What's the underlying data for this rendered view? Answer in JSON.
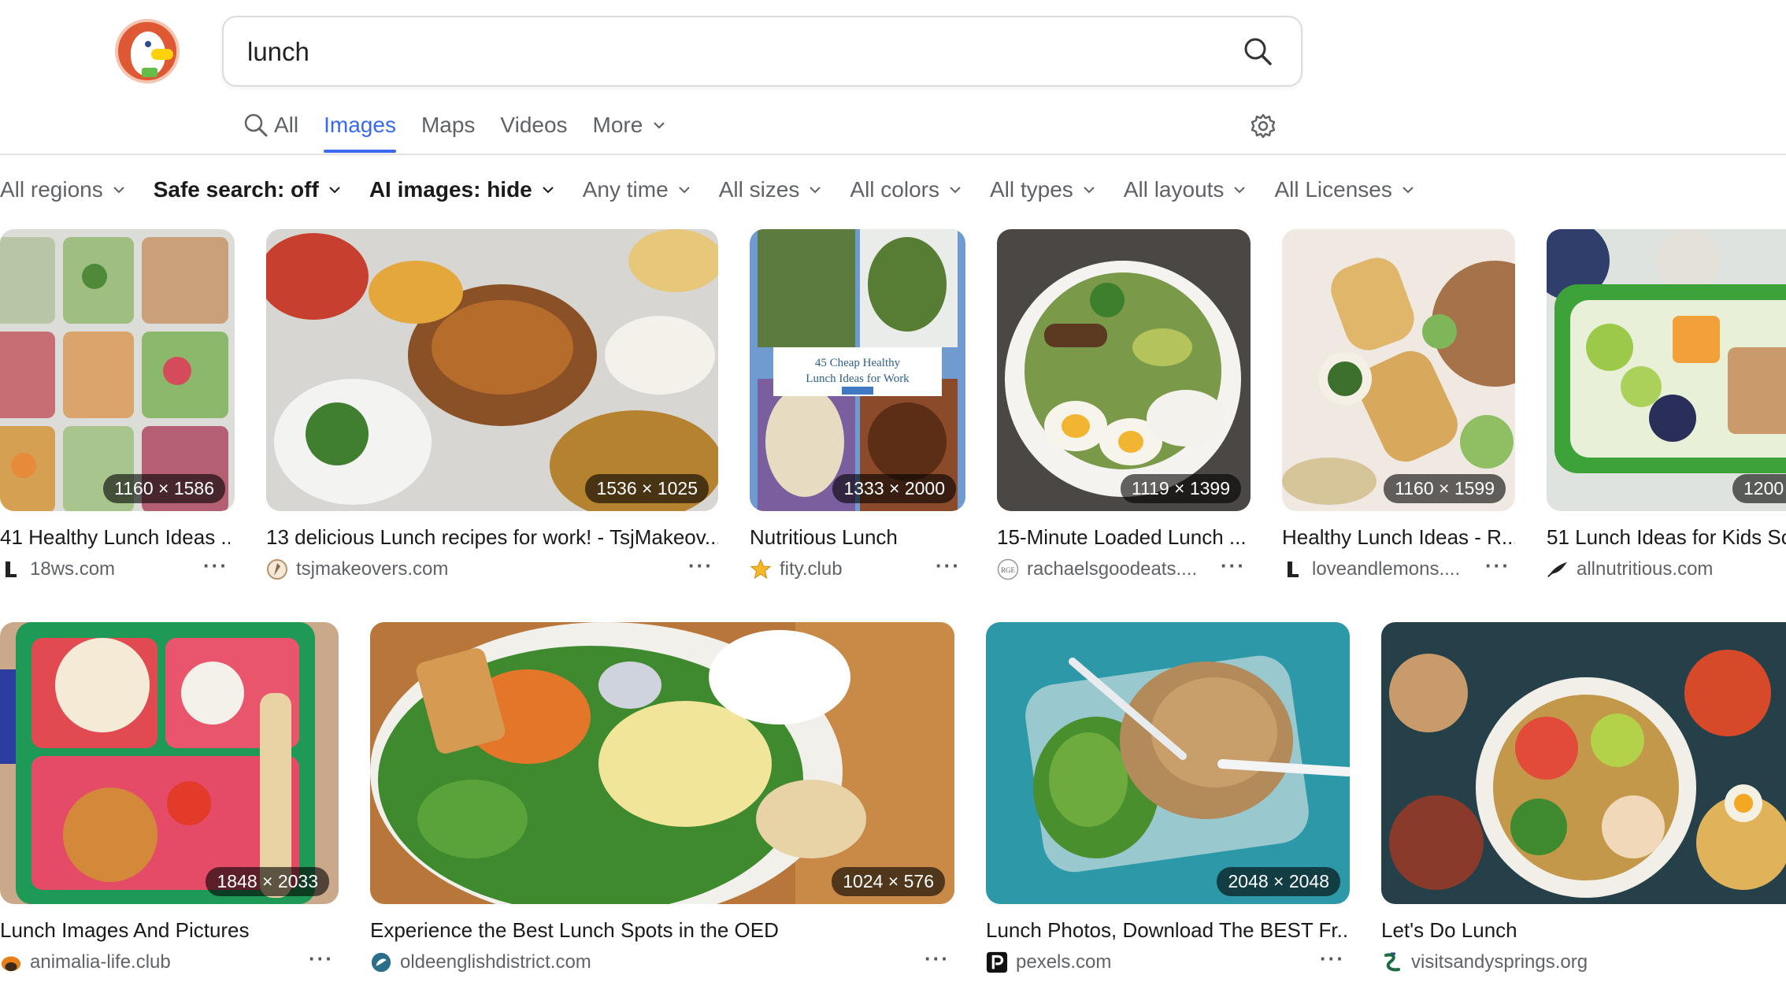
{
  "search": {
    "query": "lunch"
  },
  "tabs": [
    {
      "label": "All"
    },
    {
      "label": "Images"
    },
    {
      "label": "Maps"
    },
    {
      "label": "Videos"
    },
    {
      "label": "More"
    }
  ],
  "filters": [
    {
      "label": "All regions"
    },
    {
      "label": "Safe search: off"
    },
    {
      "label": "AI images: hide"
    },
    {
      "label": "Any time"
    },
    {
      "label": "All sizes"
    },
    {
      "label": "All colors"
    },
    {
      "label": "All types"
    },
    {
      "label": "All layouts"
    },
    {
      "label": "All Licenses"
    }
  ],
  "results": [
    {
      "title": "41 Healthy Lunch Ideas ...",
      "source": "18ws.com",
      "dims": "1160 × 1586"
    },
    {
      "title": "13 delicious Lunch recipes for work! - TsjMakeov...",
      "source": "tsjmakeovers.com",
      "dims": "1536 × 1025"
    },
    {
      "title": "Nutritious Lunch",
      "source": "fity.club",
      "dims": "1333 × 2000",
      "overlay_title": "45 Cheap Healthy",
      "overlay_subtitle": "Lunch Ideas for Work"
    },
    {
      "title": "15-Minute Loaded Lunch ...",
      "source": "rachaelsgoodeats....",
      "dims": "1119 × 1399"
    },
    {
      "title": "Healthy Lunch Ideas - R...",
      "source": "loveandlemons....",
      "dims": "1160 × 1599"
    },
    {
      "title": "51 Lunch Ideas for Kids Sc",
      "source": "allnutritious.com",
      "dims": "1200"
    },
    {
      "title": "Lunch Images And Pictures",
      "source": "animalia-life.club",
      "dims": "1848 × 2033"
    },
    {
      "title": "Experience the Best Lunch Spots in the OED",
      "source": "oldeenglishdistrict.com",
      "dims": "1024 × 576"
    },
    {
      "title": "Lunch Photos, Download The BEST Fr...",
      "source": "pexels.com",
      "dims": "2048 × 2048"
    },
    {
      "title": "Let's Do Lunch",
      "source": "visitsandysprings.org",
      "dims": ""
    }
  ],
  "more_label": "···",
  "colors": {
    "accent": "#3969ef",
    "brand": "#de5833"
  }
}
